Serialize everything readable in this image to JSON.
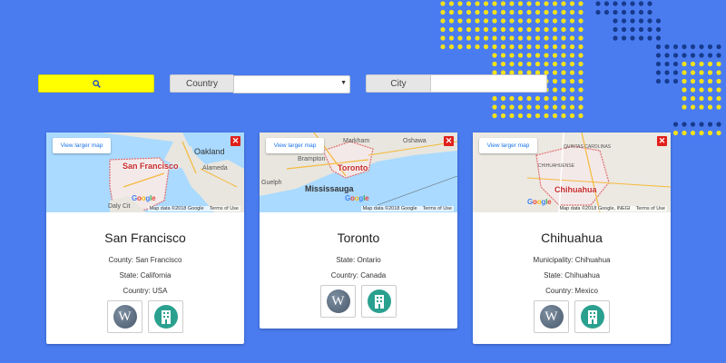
{
  "search": {
    "icon": "search-icon"
  },
  "filters": {
    "country": {
      "label": "Country",
      "value": ""
    },
    "city": {
      "label": "City",
      "value": ""
    }
  },
  "map_common": {
    "view_larger": "View larger map",
    "terms": "Terms of Use"
  },
  "cards": [
    {
      "title": "San Francisco",
      "info": [
        "County: San Francisco",
        "State: California",
        "Country: USA"
      ],
      "map": {
        "labels": [
          "Oakland",
          "Alameda",
          "Daly Cit"
        ],
        "city_label": "San Francisco",
        "data_text": "Map data ©2018 Google"
      }
    },
    {
      "title": "Toronto",
      "info": [
        "State: Ontario",
        "Country: Canada"
      ],
      "map": {
        "labels": [
          "Markham",
          "Oshawa",
          "Brampton",
          "Guelph"
        ],
        "city_label": "Toronto",
        "big_label": "Mississauga",
        "data_text": "Map data ©2018 Google"
      }
    },
    {
      "title": "Chihuahua",
      "info": [
        "Municipality: Chihuahua",
        "State: Chihuahua",
        "Country: Mexico"
      ],
      "map": {
        "labels": [
          "QUINTAS CAROLINAS",
          "CHIHUAHUENSE"
        ],
        "city_label": "Chihuahua",
        "data_text": "Map data ©2018 Google, INEGI"
      }
    }
  ],
  "link_icons": {
    "wiki_glyph": "W",
    "wiki_icon": "wikipedia-icon",
    "building_icon": "building-icon"
  },
  "colors": {
    "background": "#4a7cf0",
    "accent_yellow": "#ffff00",
    "dot_yellow": "#f5e21a",
    "dot_navy": "#173a8c",
    "close_red": "#e0201b",
    "teal": "#2aa08f"
  }
}
